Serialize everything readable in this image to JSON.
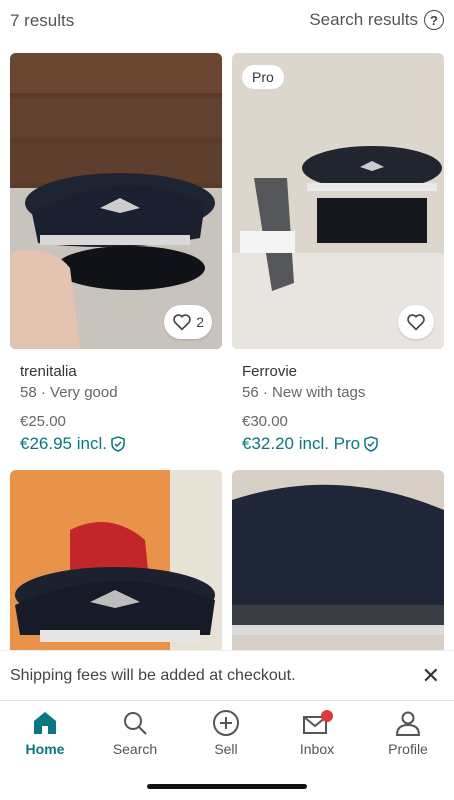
{
  "header": {
    "results_count": "7 results",
    "search_results_label": "Search results"
  },
  "items": [
    {
      "badge": "",
      "favorites": "2",
      "brand": "trenitalia",
      "detail": "58 · Very good",
      "price": "€25.00",
      "price_incl": "€26.95 incl."
    },
    {
      "badge": "Pro",
      "favorites": "",
      "brand": "Ferrovie",
      "detail": "56 · New with tags",
      "price": "€30.00",
      "price_incl": "€32.20 incl. Pro"
    }
  ],
  "banner": {
    "text": "Shipping fees will be added at checkout."
  },
  "nav": {
    "home": "Home",
    "search": "Search",
    "sell": "Sell",
    "inbox": "Inbox",
    "profile": "Profile"
  },
  "colors": {
    "accent": "#09777f",
    "notification": "#e0373a"
  },
  "icons": [
    "help-icon",
    "heart-icon",
    "shield-icon",
    "close-icon",
    "home-icon",
    "search-icon",
    "plus-circle-icon",
    "inbox-icon",
    "profile-icon"
  ]
}
